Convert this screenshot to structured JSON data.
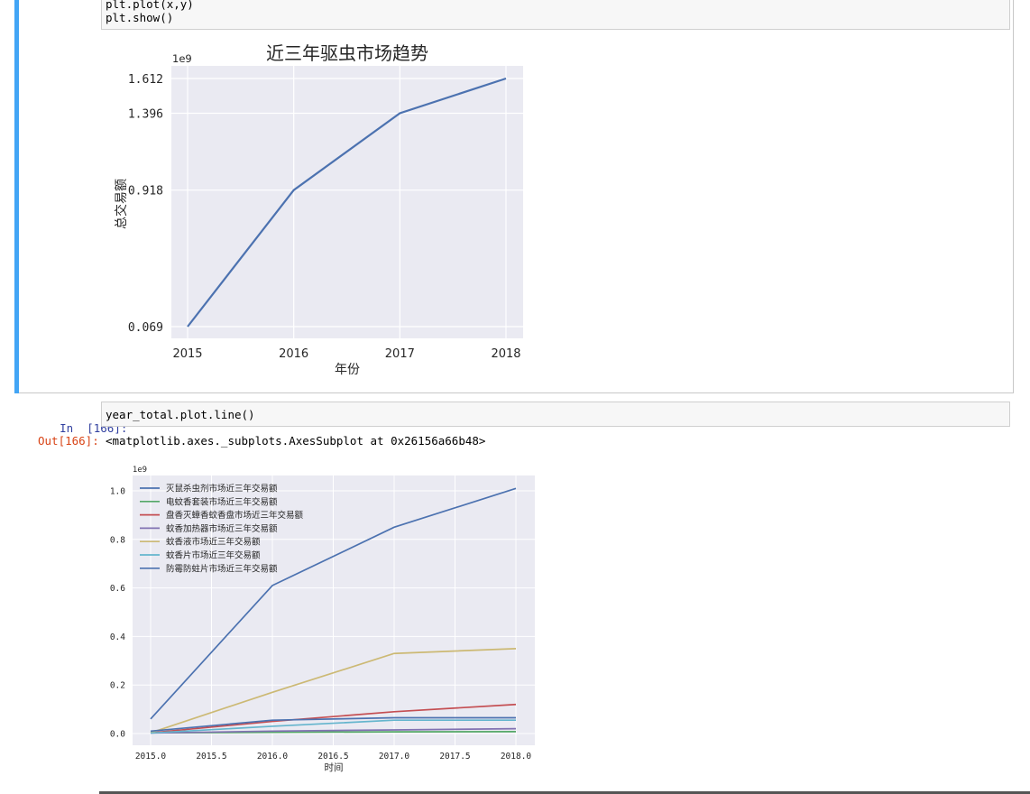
{
  "cell1": {
    "code_lines": [
      "plt.plot(x,y)",
      "plt.show()"
    ]
  },
  "cell2": {
    "in_prompt": "In  [166]:",
    "code": "year_total.plot.line()",
    "out_prompt": "Out[166]:",
    "output_text": "<matplotlib.axes._subplots.AxesSubplot at 0x26156a66b48>"
  },
  "colors": {
    "cell_selected_bar": "#42a5f5",
    "plot_background": "#eaeaf2",
    "in_prompt": "#303f9f",
    "out_prompt": "#d84315"
  },
  "chart_data": [
    {
      "type": "line",
      "title": "近三年驱虫市场趋势",
      "xlabel": "年份",
      "ylabel": "总交易额",
      "y_offset_label": "1e9",
      "x": [
        2015,
        2016,
        2017,
        2018
      ],
      "x_tick_labels": [
        "2015",
        "2016",
        "2017",
        "2018"
      ],
      "y_tick_labels": [
        "0.069",
        "0.918",
        "1.396",
        "1.612"
      ],
      "y_ticks": [
        0.069,
        0.918,
        1.396,
        1.612
      ],
      "series": [
        {
          "values": [
            0.069,
            0.918,
            1.396,
            1.612
          ],
          "color": "#4c72b0"
        }
      ],
      "ylim": [
        0.0,
        1.68
      ],
      "grid": true
    },
    {
      "type": "line",
      "title": "",
      "xlabel": "时间",
      "ylabel": "",
      "y_offset_label": "1e9",
      "x": [
        2015.0,
        2016.0,
        2017.0,
        2018.0
      ],
      "x_tick_labels": [
        "2015.0",
        "2015.5",
        "2016.0",
        "2016.5",
        "2017.0",
        "2017.5",
        "2018.0"
      ],
      "x_ticks": [
        2015.0,
        2015.5,
        2016.0,
        2016.5,
        2017.0,
        2017.5,
        2018.0
      ],
      "y_tick_labels": [
        "0.0",
        "0.2",
        "0.4",
        "0.6",
        "0.8",
        "1.0"
      ],
      "y_ticks": [
        0.0,
        0.2,
        0.4,
        0.6,
        0.8,
        1.0
      ],
      "xlim": [
        2014.9,
        2018.15
      ],
      "ylim": [
        -0.045,
        1.06
      ],
      "legend_position": "upper-left",
      "grid": true,
      "series": [
        {
          "name": "灭鼠杀虫剂市场近三年交易额",
          "values": [
            0.06,
            0.61,
            0.85,
            1.01
          ],
          "color": "#4c72b0"
        },
        {
          "name": "电蚊香套装市场近三年交易额",
          "values": [
            0.003,
            0.005,
            0.007,
            0.008
          ],
          "color": "#55a868"
        },
        {
          "name": "盘香灭蟑香蚊香盘市场近三年交易额",
          "values": [
            0.003,
            0.05,
            0.09,
            0.12
          ],
          "color": "#c44e52"
        },
        {
          "name": "蚊香加热器市场近三年交易额",
          "values": [
            0.002,
            0.01,
            0.015,
            0.02
          ],
          "color": "#8172b2"
        },
        {
          "name": "蚊香液市场近三年交易额",
          "values": [
            0.003,
            0.17,
            0.33,
            0.35
          ],
          "color": "#ccb974"
        },
        {
          "name": "蚊香片市场近三年交易额",
          "values": [
            0.002,
            0.03,
            0.055,
            0.055
          ],
          "color": "#64b5cd"
        },
        {
          "name": "防霉防蛀片市场近三年交易额",
          "values": [
            0.01,
            0.055,
            0.065,
            0.065
          ],
          "color": "#4c72b0"
        }
      ]
    }
  ]
}
